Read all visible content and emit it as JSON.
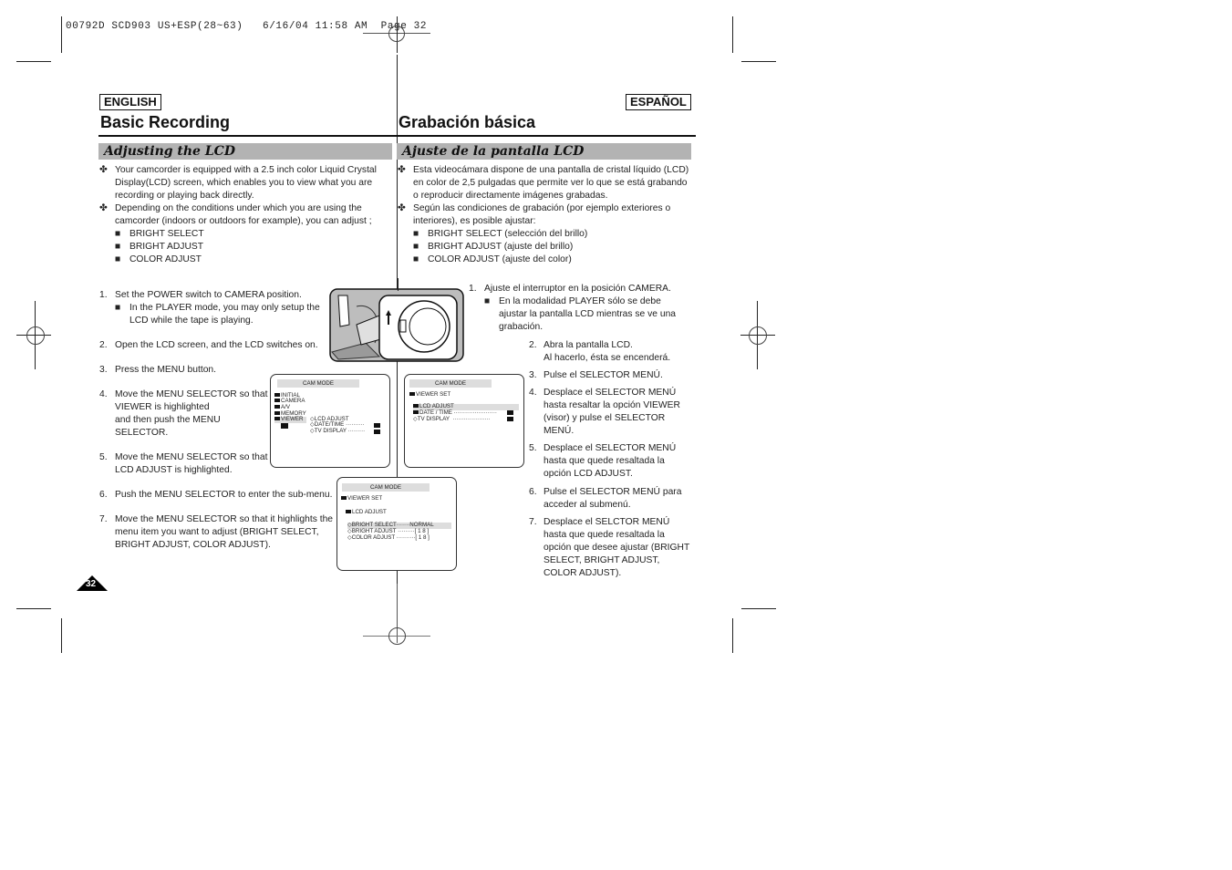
{
  "print_header": "00792D SCD903 US+ESP(28~63)   6/16/04 11:58 AM  Page 32",
  "english": {
    "lang_label": "ENGLISH",
    "title": "Basic Recording",
    "section": "Adjusting the LCD",
    "intro": [
      {
        "bullet": "✤",
        "lines": [
          "Your camcorder is equipped with a 2.5 inch color Liquid Crystal",
          "Display(LCD) screen, which enables you to view what you are",
          "recording or playing back directly."
        ]
      },
      {
        "bullet": "✤",
        "lines": [
          "Depending on the conditions under which you are using the",
          "camcorder (indoors or outdoors for example), you can adjust ;"
        ]
      }
    ],
    "options": [
      "BRIGHT SELECT",
      "BRIGHT ADJUST",
      "COLOR ADJUST"
    ],
    "steps": [
      {
        "n": "1.",
        "lines": [
          "Set the POWER switch to CAMERA position."
        ],
        "note": [
          "In the PLAYER mode, you may only setup the",
          "LCD while the tape is playing."
        ]
      },
      {
        "n": "2.",
        "lines": [
          "Open the LCD screen, and the LCD switches on."
        ]
      },
      {
        "n": "3.",
        "lines": [
          "Press the MENU button."
        ]
      },
      {
        "n": "4.",
        "lines": [
          "Move the MENU SELECTOR so that",
          "VIEWER is highlighted",
          "and then push the MENU",
          "SELECTOR."
        ]
      },
      {
        "n": "5.",
        "lines": [
          "Move the MENU SELECTOR so that",
          "LCD ADJUST is highlighted."
        ]
      },
      {
        "n": "6.",
        "lines": [
          "Push the MENU SELECTOR to enter the sub-menu."
        ]
      },
      {
        "n": "7.",
        "lines": [
          "Move the MENU SELECTOR so that it highlights the",
          "menu item you want to adjust (BRIGHT SELECT,",
          "BRIGHT ADJUST, COLOR ADJUST)."
        ]
      }
    ],
    "page_number": "32"
  },
  "spanish": {
    "lang_label": "ESPAÑOL",
    "title": "Grabación básica",
    "section": "Ajuste de la pantalla LCD",
    "intro": [
      {
        "bullet": "✤",
        "lines": [
          "Esta videocámara dispone de una pantalla de cristal líquido (LCD)",
          "en color de 2,5 pulgadas que permite ver lo que se está grabando",
          "o reproducir directamente imágenes grabadas."
        ]
      },
      {
        "bullet": "✤",
        "lines": [
          "Según las condiciones de grabación (por ejemplo exteriores o",
          "interiores), es posible ajustar:"
        ]
      }
    ],
    "options": [
      "BRIGHT SELECT (selección del brillo)",
      "BRIGHT ADJUST (ajuste del brillo)",
      "COLOR ADJUST (ajuste del color)"
    ],
    "steps": [
      {
        "n": "1.",
        "lines": [
          "Ajuste el interruptor en la posición CAMERA."
        ],
        "note": [
          "En la modalidad PLAYER sólo se debe",
          "ajustar la pantalla LCD mientras se ve una",
          "grabación."
        ]
      },
      {
        "n": "2.",
        "lines": [
          "Abra la pantalla LCD.",
          "Al hacerlo, ésta se encenderá."
        ]
      },
      {
        "n": "3.",
        "lines": [
          "Pulse el SELECTOR MENÚ."
        ]
      },
      {
        "n": "4.",
        "lines": [
          "Desplace el SELECTOR MENÚ",
          "hasta resaltar la opción VIEWER",
          "(visor) y pulse el SELECTOR",
          "MENÚ."
        ]
      },
      {
        "n": "5.",
        "lines": [
          "Desplace el SELECTOR MENÚ",
          "hasta que quede resaltada la",
          "opción LCD ADJUST."
        ]
      },
      {
        "n": "6.",
        "lines": [
          "Pulse el SELECTOR MENÚ para",
          "acceder al submenú."
        ]
      },
      {
        "n": "7.",
        "lines": [
          "Desplace el SELCTOR MENÚ",
          "hasta que quede resaltada la",
          "opción que desee ajustar (BRIGHT",
          "SELECT, BRIGHT ADJUST,",
          "COLOR ADJUST)."
        ]
      }
    ]
  },
  "menus": {
    "menu1": {
      "header": "CAM  MODE",
      "items": [
        "INITIAL",
        "CAMERA",
        "A/V",
        "MEMORY",
        "VIEWER"
      ],
      "highlighted": "VIEWER",
      "sub": [
        "◇LCD ADJUST",
        "◇DATE/TIME ··········",
        "◇TV DISPLAY ·········"
      ]
    },
    "menu2": {
      "header": "CAM  MODE",
      "title": "VIEWER SET",
      "items": [
        "LCD ADJUST",
        "DATE / TIME ·······················",
        "◇TV DISPLAY  ····················"
      ],
      "highlighted": "LCD ADJUST"
    },
    "menu3": {
      "header": "CAM  MODE",
      "title": "VIEWER SET",
      "sub_title": "LCD ADJUST",
      "items": [
        {
          "label": "◇BRIGHT SELECT·······",
          "value": "NORMAL"
        },
        {
          "label": "◇BRIGHT ADJUST ·········",
          "value": "[ 1 8 ]"
        },
        {
          "label": "◇COLOR ADJUST ··········",
          "value": "[ 1 8 ]"
        }
      ],
      "highlighted": "BRIGHT SELECT"
    }
  },
  "illustration": {
    "label": "camcorder-power-switch"
  }
}
